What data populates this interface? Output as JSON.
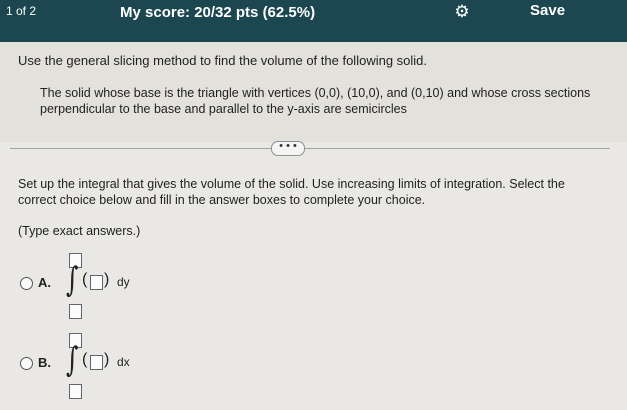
{
  "topbar": {
    "counter": "1 of 2",
    "score": "My score: 20/32 pts (62.5%)",
    "gear_icon": "gear-icon",
    "save_label": "Save",
    "colors": {
      "background": "#1d4750",
      "text": "#ffffff"
    }
  },
  "instruction": {
    "main": "Use the general slicing method to find the volume of the following solid.",
    "detail": "The solid whose base is the triangle with vertices (0,0), (10,0), and (0,10) and whose cross sections perpendicular to the base and parallel to the y-axis are semicircles"
  },
  "more_button": "• • •",
  "question": {
    "setup": "Set up the integral that gives the volume of the solid. Use increasing limits of integration. Select the correct choice below and fill in the answer boxes to complete your choice.",
    "type_exact": "(Type exact answers.)"
  },
  "choices": [
    {
      "label": "A.",
      "paren_open": "(",
      "paren_close": ")",
      "differential": "dy"
    },
    {
      "label": "B.",
      "paren_open": "(",
      "paren_close": ")",
      "differential": "dx"
    }
  ],
  "integral_symbol": "∫"
}
